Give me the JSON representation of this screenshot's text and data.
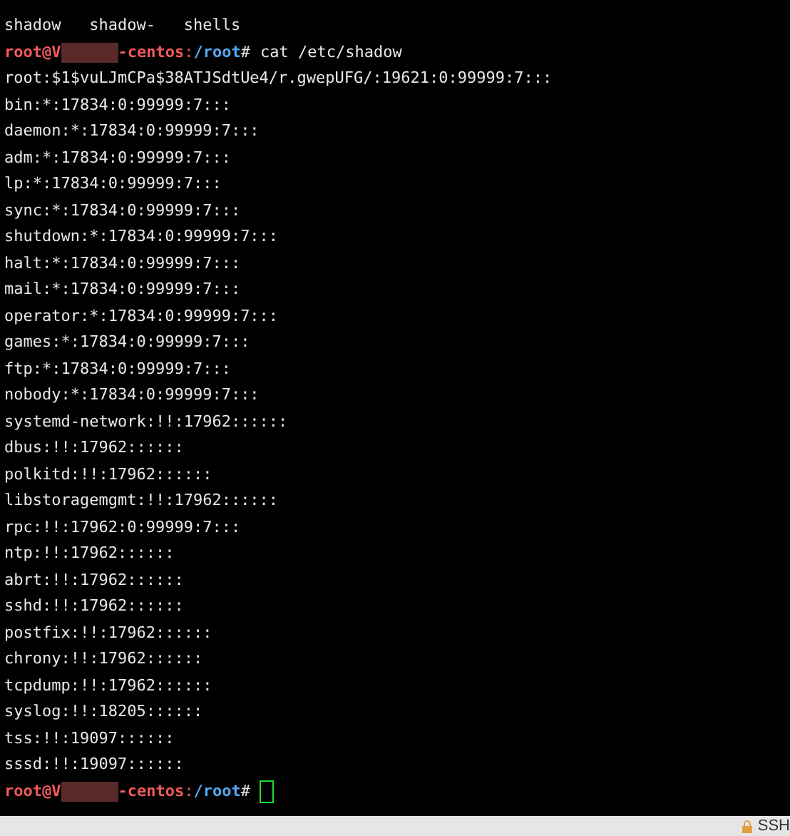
{
  "terminal": {
    "lines": [
      {
        "kind": "output",
        "text": "shadow   shadow-   shells"
      },
      {
        "kind": "prompt",
        "user": "root@V",
        "host": "-centos",
        "sep": ":",
        "path": "/root",
        "mark": "#",
        "command": "cat /etc/shadow"
      },
      {
        "kind": "output",
        "text": "root:$1$vuLJmCPa$38ATJSdtUe4/r.gwepUFG/:19621:0:99999:7:::"
      },
      {
        "kind": "output",
        "text": "bin:*:17834:0:99999:7:::"
      },
      {
        "kind": "output",
        "text": "daemon:*:17834:0:99999:7:::"
      },
      {
        "kind": "output",
        "text": "adm:*:17834:0:99999:7:::"
      },
      {
        "kind": "output",
        "text": "lp:*:17834:0:99999:7:::"
      },
      {
        "kind": "output",
        "text": "sync:*:17834:0:99999:7:::"
      },
      {
        "kind": "output",
        "text": "shutdown:*:17834:0:99999:7:::"
      },
      {
        "kind": "output",
        "text": "halt:*:17834:0:99999:7:::"
      },
      {
        "kind": "output",
        "text": "mail:*:17834:0:99999:7:::"
      },
      {
        "kind": "output",
        "text": "operator:*:17834:0:99999:7:::"
      },
      {
        "kind": "output",
        "text": "games:*:17834:0:99999:7:::"
      },
      {
        "kind": "output",
        "text": "ftp:*:17834:0:99999:7:::"
      },
      {
        "kind": "output",
        "text": "nobody:*:17834:0:99999:7:::"
      },
      {
        "kind": "output",
        "text": "systemd-network:!!:17962::::::"
      },
      {
        "kind": "output",
        "text": "dbus:!!:17962::::::"
      },
      {
        "kind": "output",
        "text": "polkitd:!!:17962::::::"
      },
      {
        "kind": "output",
        "text": "libstoragemgmt:!!:17962::::::"
      },
      {
        "kind": "output",
        "text": "rpc:!!:17962:0:99999:7:::"
      },
      {
        "kind": "output",
        "text": "ntp:!!:17962::::::"
      },
      {
        "kind": "output",
        "text": "abrt:!!:17962::::::"
      },
      {
        "kind": "output",
        "text": "sshd:!!:17962::::::"
      },
      {
        "kind": "output",
        "text": "postfix:!!:17962::::::"
      },
      {
        "kind": "output",
        "text": "chrony:!!:17962::::::"
      },
      {
        "kind": "output",
        "text": "tcpdump:!!:17962::::::"
      },
      {
        "kind": "output",
        "text": "syslog:!!:18205::::::"
      },
      {
        "kind": "output",
        "text": "tss:!!:19097::::::"
      },
      {
        "kind": "output",
        "text": "sssd:!!:19097::::::"
      },
      {
        "kind": "prompt",
        "user": "root@V",
        "host": "-centos",
        "sep": ":",
        "path": "/root",
        "mark": "#"
      }
    ]
  },
  "status_bar": {
    "label": "SSH"
  }
}
